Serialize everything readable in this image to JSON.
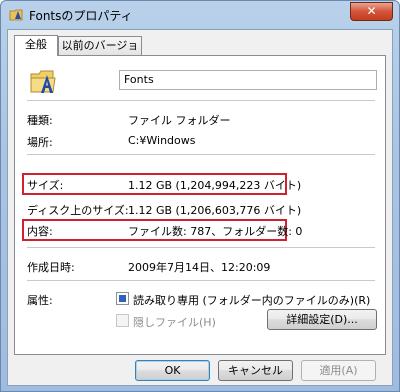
{
  "window": {
    "title": "Fontsのプロパティ",
    "close_label": "✕"
  },
  "tabs": [
    {
      "label": "全般"
    },
    {
      "label": "以前のバージョン"
    }
  ],
  "name_field": {
    "value": "Fonts"
  },
  "properties": {
    "type": {
      "label": "種類:",
      "value": "ファイル フォルダー"
    },
    "location": {
      "label": "場所:",
      "value": "C:¥Windows"
    },
    "size": {
      "label": "サイズ:",
      "value": "1.12 GB (1,204,994,223 バイト)"
    },
    "size_on_disk": {
      "label": "ディスク上のサイズ:",
      "value": "1.12 GB (1,206,603,776 バイト)"
    },
    "contents": {
      "label": "内容:",
      "value": "ファイル数: 787、フォルダー数: 0"
    },
    "created": {
      "label": "作成日時:",
      "value": "2009年7月14日、12:20:09"
    }
  },
  "attributes": {
    "label": "属性:",
    "readonly": {
      "label": "読み取り専用 (フォルダー内のファイルのみ)(R)",
      "state": "indeterminate"
    },
    "hidden": {
      "label": "隠しファイル(H)",
      "state": "unchecked-disabled"
    },
    "advanced_button": "詳細設定(D)..."
  },
  "footer": {
    "ok": "OK",
    "cancel": "キャンセル",
    "apply": "適用(A)"
  },
  "colors": {
    "highlight_box": "#d1202f",
    "panel_bg": "#ffffff",
    "dialog_bg": "#f0f0f0"
  }
}
